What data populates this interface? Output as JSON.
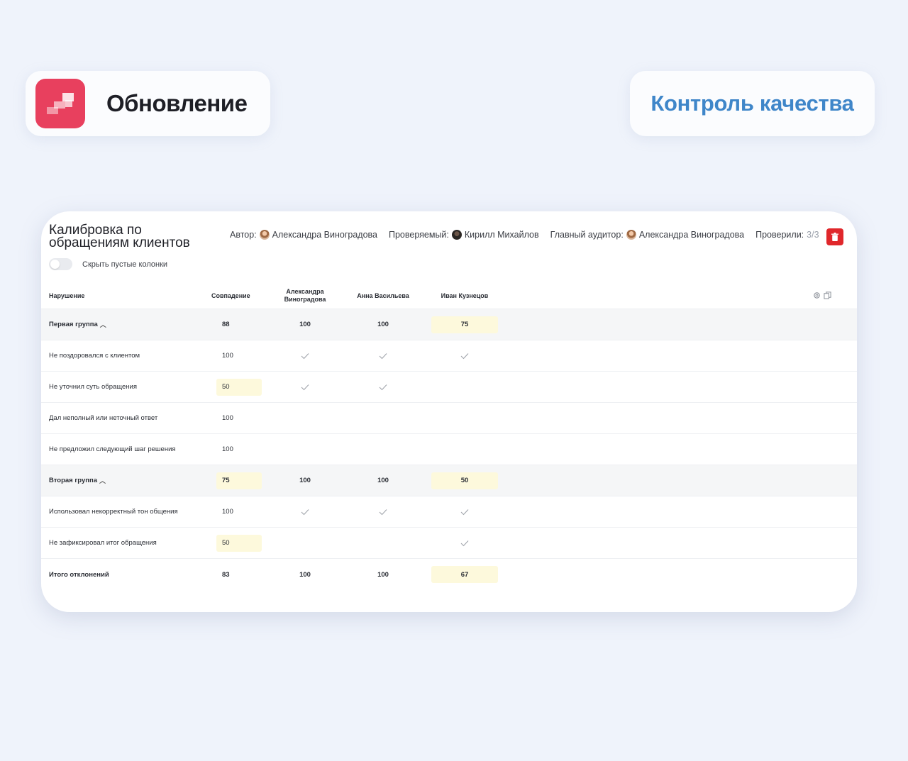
{
  "badges": {
    "update_title": "Обновление",
    "qc_title": "Контроль качества"
  },
  "header": {
    "title_line1": "Калибровка по",
    "title_line2": "обращениям клиентов",
    "author_label": "Автор:",
    "author_name": "Александра Виноградова",
    "reviewee_label": "Проверяемый:",
    "reviewee_name": "Кирилл Михайлов",
    "chief_label": "Главный аудитор:",
    "chief_name": "Александра Виноградова",
    "checked_label": "Проверили:",
    "checked_value": "3/3",
    "hide_empty_label": "Скрыть пустые колонки"
  },
  "table": {
    "columns": {
      "violation": "Нарушение",
      "match": "Совпадение",
      "auditor1_line1": "Александра",
      "auditor1_line2": "Виноградова",
      "auditor2": "Анна Васильева",
      "auditor3": "Иван Кузнецов"
    },
    "rows": [
      {
        "name": "Первая группа",
        "match": "88",
        "a": "100",
        "b": "100",
        "c": "75"
      },
      {
        "name": "Не поздоровался с клиентом",
        "match": "100"
      },
      {
        "name": "Не уточнил суть обращения",
        "match": "50"
      },
      {
        "name": "Дал неполный или неточный ответ",
        "match": "100"
      },
      {
        "name": "Не предложил следующий шаг решения",
        "match": "100"
      },
      {
        "name": "Вторая группа",
        "match": "75",
        "a": "100",
        "b": "100",
        "c": "50"
      },
      {
        "name": "Использовал некорректный тон общения",
        "match": "100"
      },
      {
        "name": "Не зафиксировал итог обращения",
        "match": "50"
      },
      {
        "name": "Итого отклонений",
        "match": "83",
        "a": "100",
        "b": "100",
        "c": "67"
      }
    ]
  },
  "colors": {
    "accent_logo": "#e8405e",
    "qc_title": "#3f86c9",
    "delete_button": "#e0272b",
    "highlight_cell": "#fdf9dc"
  }
}
